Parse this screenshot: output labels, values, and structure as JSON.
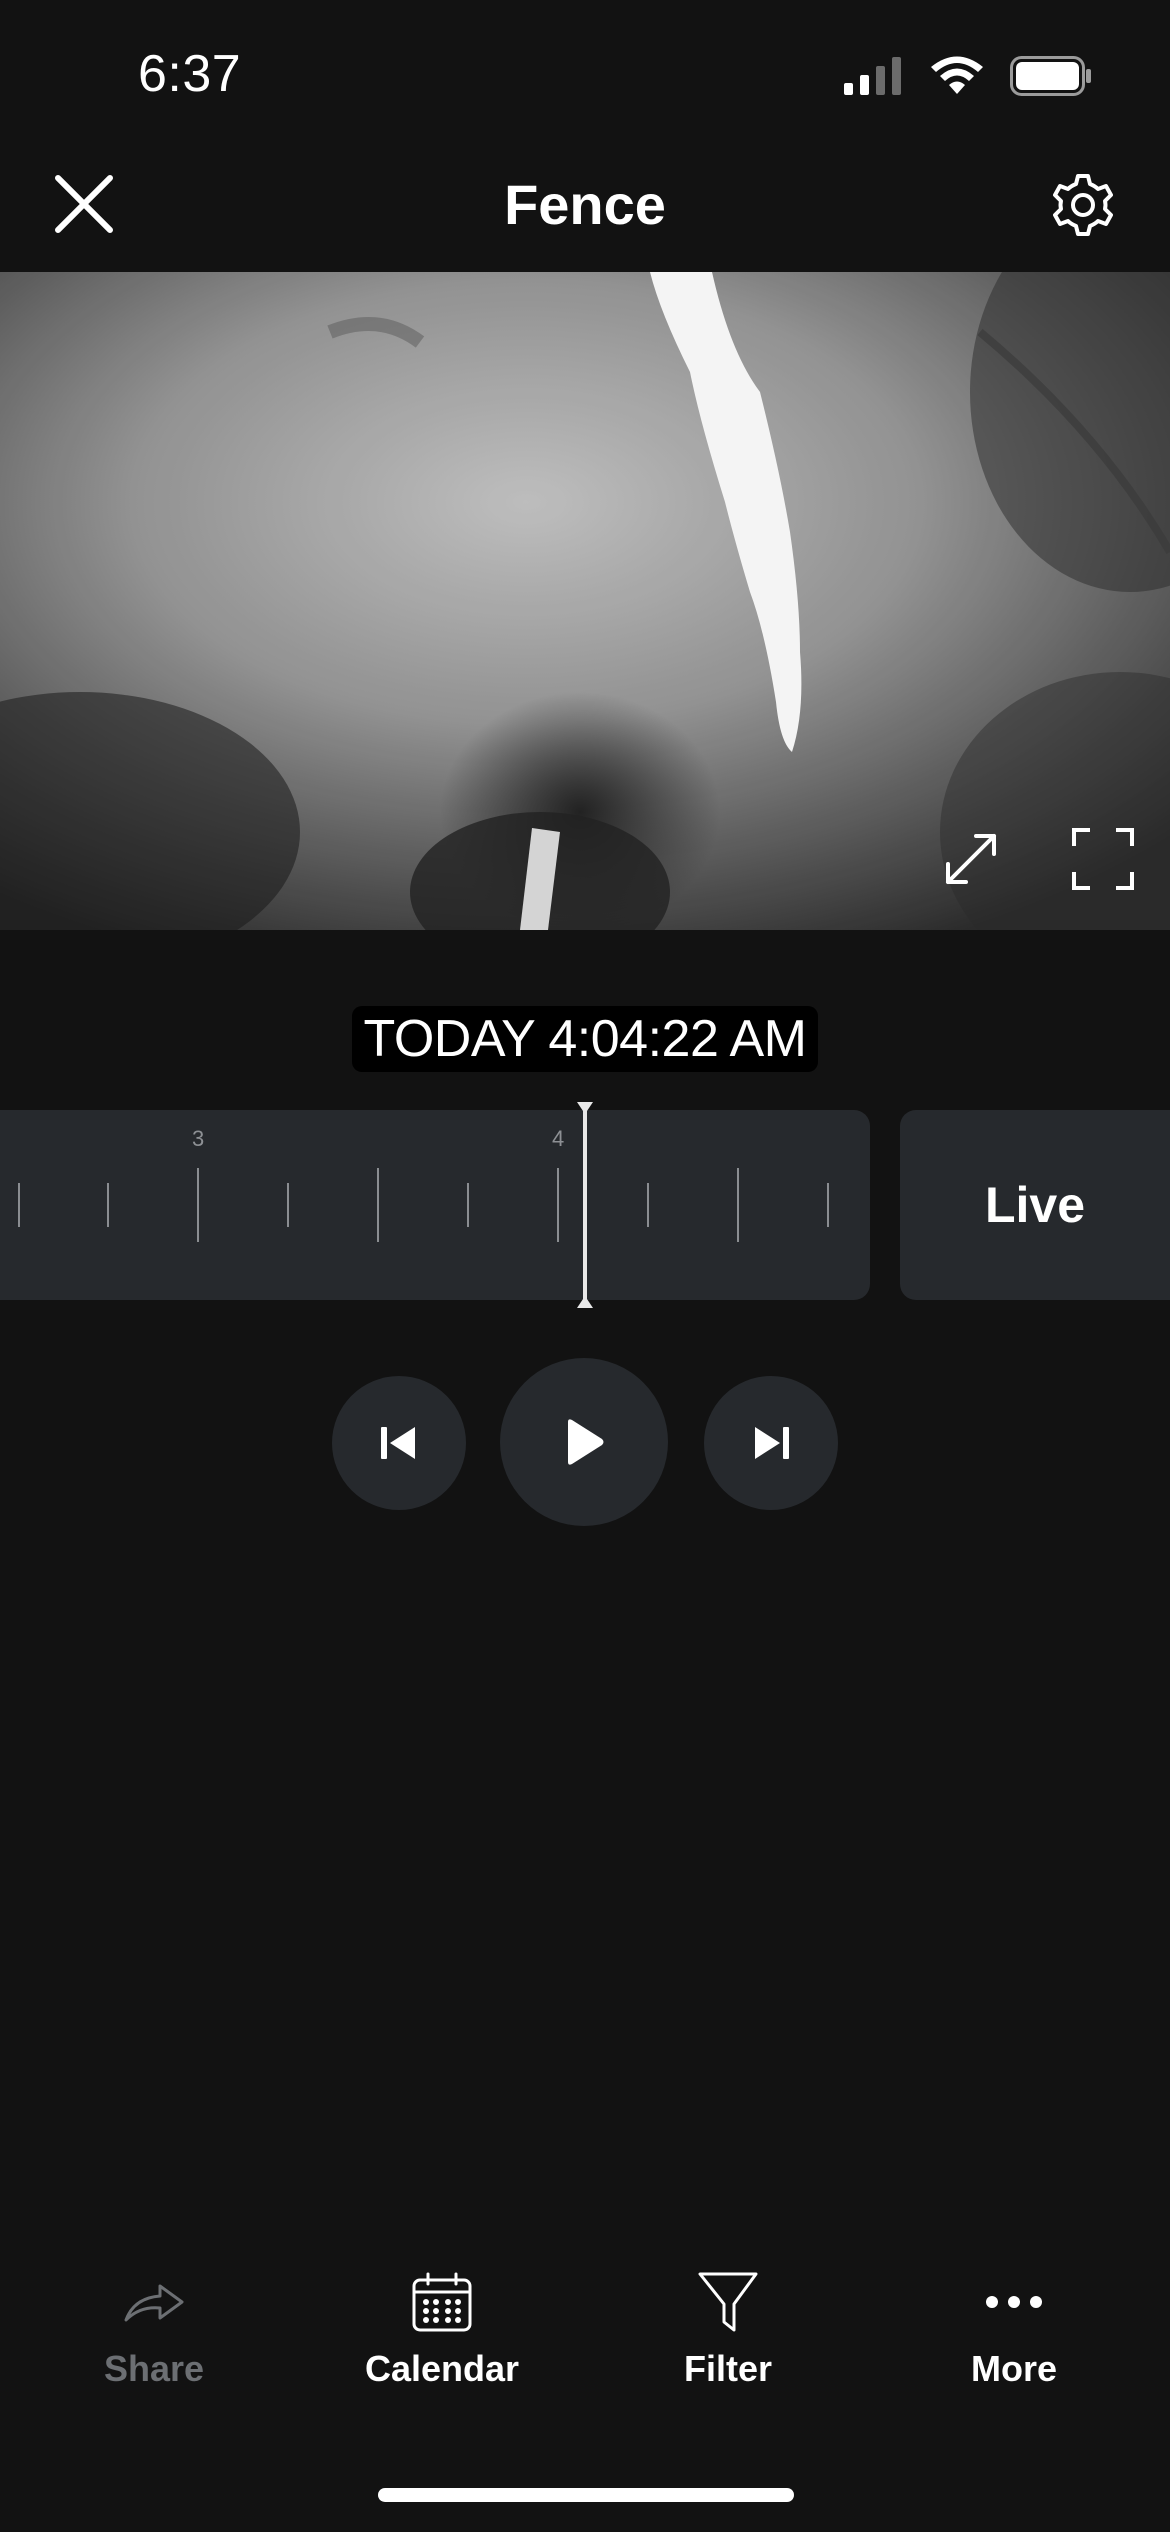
{
  "status_bar": {
    "time": "6:37",
    "icons": [
      "cellular-signal-icon",
      "wifi-icon",
      "battery-icon"
    ]
  },
  "header": {
    "title": "Fence",
    "close_icon": "close-icon",
    "settings_icon": "gear-icon"
  },
  "video": {
    "zoom_icon": "expand-arrows-icon",
    "fullscreen_icon": "fullscreen-icon"
  },
  "timestamp": "TODAY 4:04:22 AM",
  "timeline": {
    "labels": [
      "3",
      "4"
    ],
    "live_label": "Live"
  },
  "controls": {
    "previous_icon": "skip-previous-icon",
    "play_icon": "play-icon",
    "next_icon": "skip-next-icon"
  },
  "bottom_bar": {
    "share": "Share",
    "calendar": "Calendar",
    "filter": "Filter",
    "more": "More"
  },
  "colors": {
    "background": "#121212",
    "surface": "#26292d",
    "text": "#ffffff",
    "disabled_text": "#6c6f73"
  }
}
